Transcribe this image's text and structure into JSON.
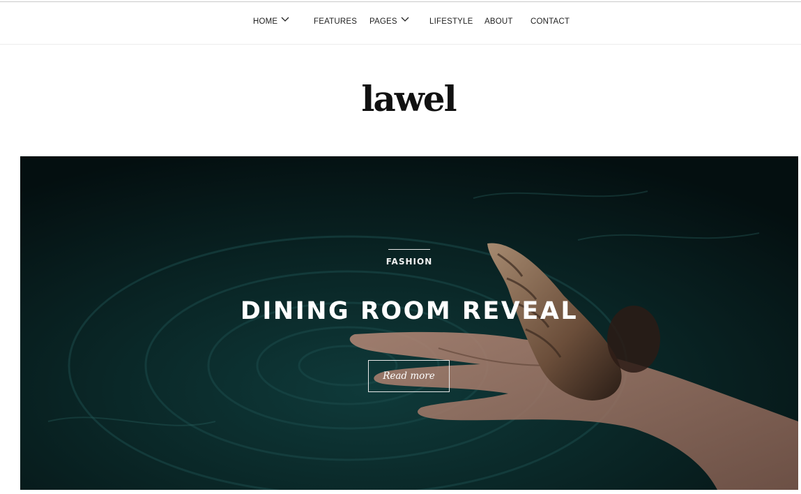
{
  "nav": {
    "items": [
      {
        "label": "HOME",
        "has_dropdown": true
      },
      {
        "label": "FEATURES",
        "has_dropdown": false
      },
      {
        "label": "PAGES",
        "has_dropdown": true
      },
      {
        "label": "LIFESTYLE",
        "has_dropdown": false
      },
      {
        "label": "ABOUT",
        "has_dropdown": false
      },
      {
        "label": "CONTACT",
        "has_dropdown": false
      }
    ],
    "dropdown_icon": "chevron-down-icon"
  },
  "site": {
    "logo": "lawel"
  },
  "hero": {
    "category": "FASHION",
    "title": "DINING ROOM REVEAL",
    "button_label": "Read more"
  },
  "colors": {
    "text": "#222222",
    "logo": "#111111",
    "hero_bg": "#071a1a",
    "hero_text": "#ffffff"
  }
}
